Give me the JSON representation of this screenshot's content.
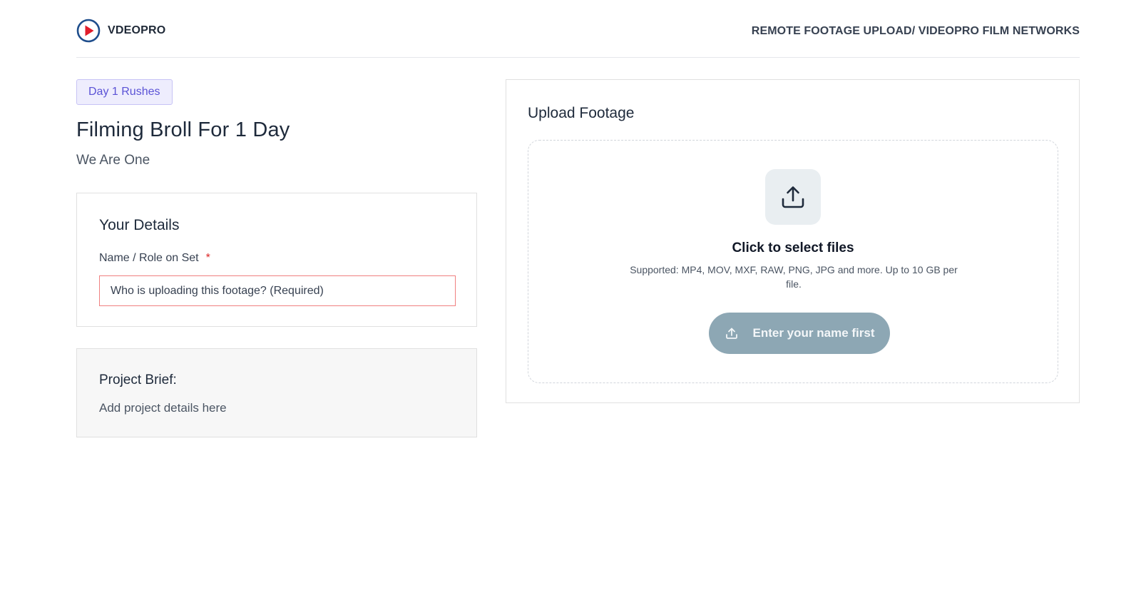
{
  "header": {
    "brand_name": "VDEOPRO",
    "right_text": "REMOTE FOOTAGE UPLOAD/ VIDEOPRO FILM NETWORKS"
  },
  "project": {
    "badge": "Day 1 Rushes",
    "title": "Filming Broll For 1 Day",
    "subtitle": "We Are One"
  },
  "details": {
    "heading": "Your Details",
    "name_label": "Name / Role on Set",
    "required_marker": "*",
    "name_value": "",
    "name_placeholder": "Who is uploading this footage? (Required)"
  },
  "brief": {
    "heading": "Project Brief:",
    "body": "Add project details here"
  },
  "upload": {
    "heading": "Upload Footage",
    "dropzone_title": "Click to select files",
    "dropzone_hint": "Supported: MP4, MOV, MXF, RAW, PNG, JPG and more. Up to 10 GB per file.",
    "button_label": "Enter your name first"
  },
  "icons": {
    "logo": "play-circle-icon",
    "dropzone_icon": "upload-icon",
    "button_icon": "upload-icon"
  },
  "colors": {
    "logo_ring": "#1f4e8c",
    "logo_play": "#e11d2a",
    "badge_bg": "#eeedfd",
    "badge_text": "#5b53d6",
    "required": "#dc2626",
    "input_border_error": "#f08080",
    "button_disabled": "#8da7b4"
  }
}
